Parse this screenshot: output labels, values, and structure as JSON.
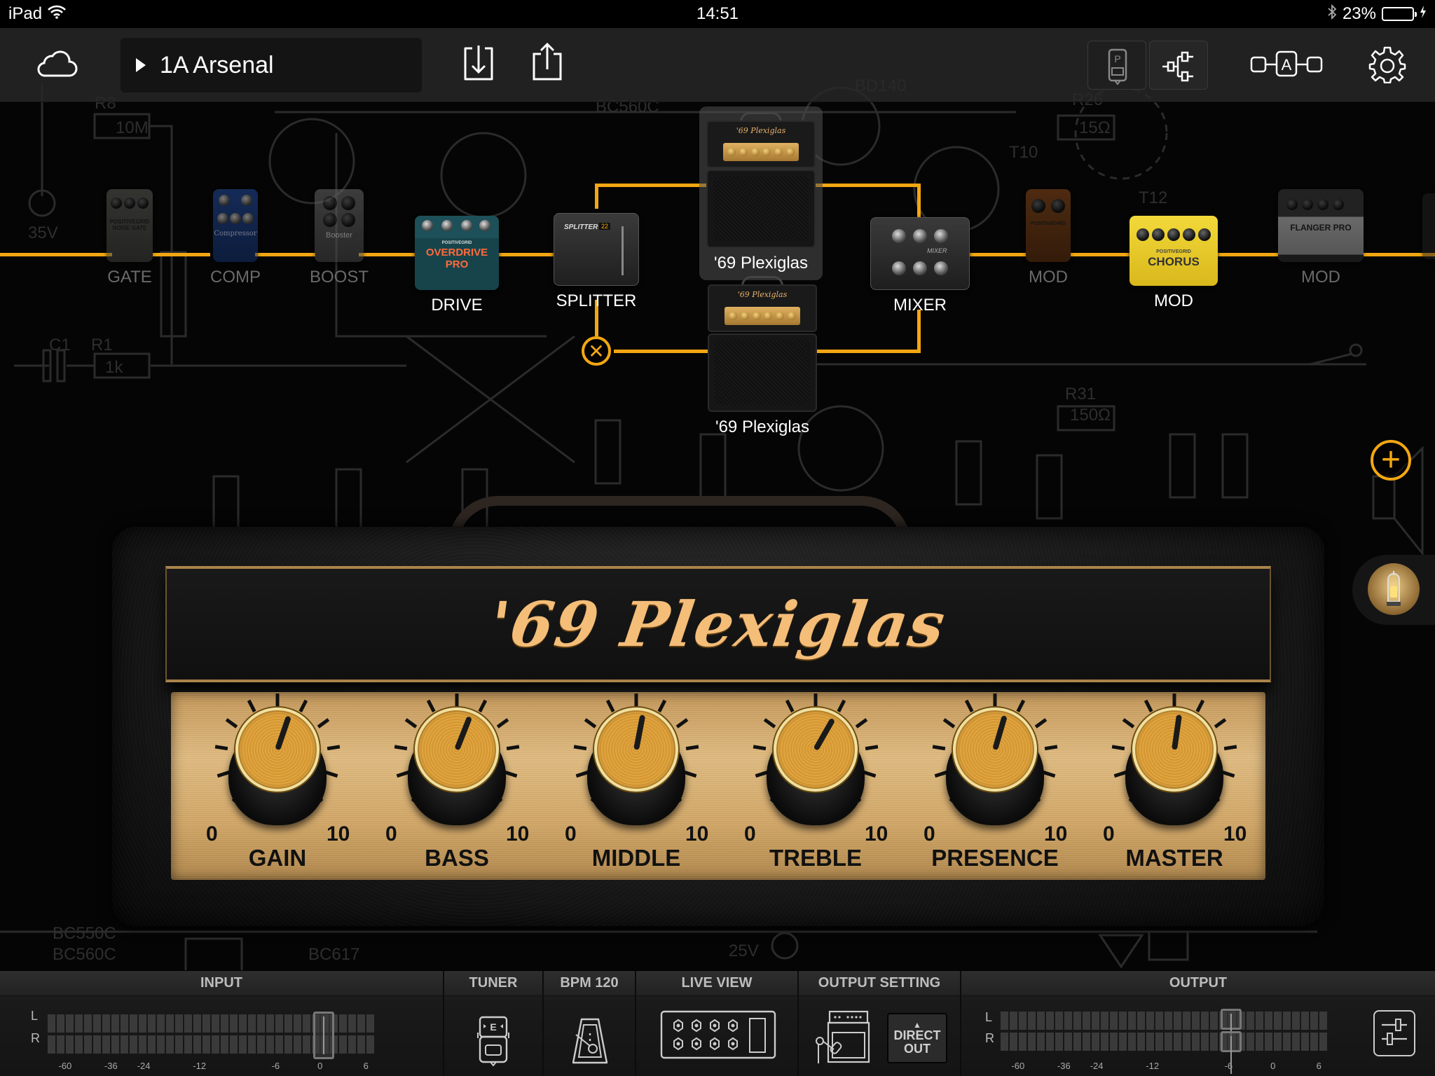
{
  "status_bar": {
    "device": "iPad",
    "time": "14:51",
    "battery_percent": "23%",
    "battery_level": 0.23,
    "charging": true,
    "bluetooth": true,
    "wifi": true
  },
  "toolbar": {
    "cloud_icon": "cloud-icon",
    "preset_name": "1A Arsenal",
    "save_icon": "download-icon",
    "share_icon": "share-icon",
    "view_modes": [
      {
        "name": "pedalboard-view-icon",
        "glyph": "P",
        "active": false
      },
      {
        "name": "signal-chain-view-icon",
        "active": true
      }
    ],
    "ab_compare_glyph": "A",
    "settings_icon": "gear-icon"
  },
  "chain": {
    "blocks": [
      {
        "label": "GATE",
        "model": "POSITIVEGRID NOISE GATE",
        "active": false
      },
      {
        "label": "COMP",
        "model": "Compressor",
        "active": false
      },
      {
        "label": "BOOST",
        "model": "Booster",
        "active": false
      },
      {
        "label": "DRIVE",
        "model": "OVERDRIVE PRO",
        "brand": "POSITIVEGRID",
        "active": true
      },
      {
        "label": "SPLITTER",
        "model": "SPLITTER",
        "display": "22",
        "active": true
      },
      {
        "label": "'69 Plexiglas",
        "model": "'69 Plexiglas",
        "path": "A",
        "selected": true
      },
      {
        "label": "'69 Plexiglas",
        "model": "'69 Plexiglas",
        "path": "B",
        "selected": false
      },
      {
        "label": "MIXER",
        "model": "MIXER",
        "active": true
      },
      {
        "label": "MOD",
        "model": "POSITIVEGRID",
        "active": false
      },
      {
        "label": "MOD",
        "model": "CHORUS",
        "brand": "POSITIVEGRID",
        "active": true
      },
      {
        "label": "MOD",
        "model": "FLANGER PRO",
        "active": false
      }
    ],
    "remove_path_icon": "close-icon",
    "wire_color": "#f3a712"
  },
  "amp": {
    "name": "'69 Plexiglas",
    "knobs": [
      {
        "label": "GAIN",
        "min": "0",
        "max": "10",
        "value": 5.7
      },
      {
        "label": "BASS",
        "min": "0",
        "max": "10",
        "value": 5.8
      },
      {
        "label": "MIDDLE",
        "min": "0",
        "max": "10",
        "value": 5.4
      },
      {
        "label": "TREBLE",
        "min": "0",
        "max": "10",
        "value": 6.1
      },
      {
        "label": "PRESENCE",
        "min": "0",
        "max": "10",
        "value": 5.6
      },
      {
        "label": "MASTER",
        "min": "0",
        "max": "10",
        "value": 5.3
      }
    ]
  },
  "side": {
    "add_icon": "plus-icon",
    "tube_icon": "vacuum-tube-icon"
  },
  "bottom_bar": {
    "input": {
      "title": "INPUT",
      "channels": [
        "L",
        "R"
      ],
      "scale": [
        "-60",
        "-36",
        "-24",
        "-12",
        "-6",
        "0",
        "6"
      ],
      "fader_db": 0
    },
    "tuner": {
      "title": "TUNER",
      "note": "E"
    },
    "bpm": {
      "title": "BPM 120"
    },
    "live_view": {
      "title": "LIVE VIEW"
    },
    "output_setting": {
      "title": "OUTPUT SETTING",
      "direct_out_line1": "DIRECT",
      "direct_out_line2": "OUT",
      "arrow": "▲"
    },
    "output": {
      "title": "OUTPUT",
      "channels": [
        "L",
        "R"
      ],
      "scale": [
        "-60",
        "-36",
        "-24",
        "-12",
        "-6",
        "0",
        "6"
      ],
      "fader_db": -6
    }
  }
}
